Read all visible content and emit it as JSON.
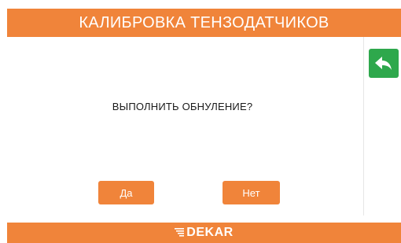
{
  "header": {
    "title": "КАЛИБРОВКА ТЕНЗОДАТЧИКОВ"
  },
  "dialog": {
    "prompt": "ВЫПОЛНИТЬ ОБНУЛЕНИЕ?",
    "yes_label": "Да",
    "no_label": "Нет"
  },
  "sidebar": {
    "back_icon": "undo-arrow-icon"
  },
  "footer": {
    "logo_text": "DEKAR"
  },
  "colors": {
    "accent": "#f0843a",
    "back_button": "#2ea84c",
    "text": "#1a1a1a"
  }
}
